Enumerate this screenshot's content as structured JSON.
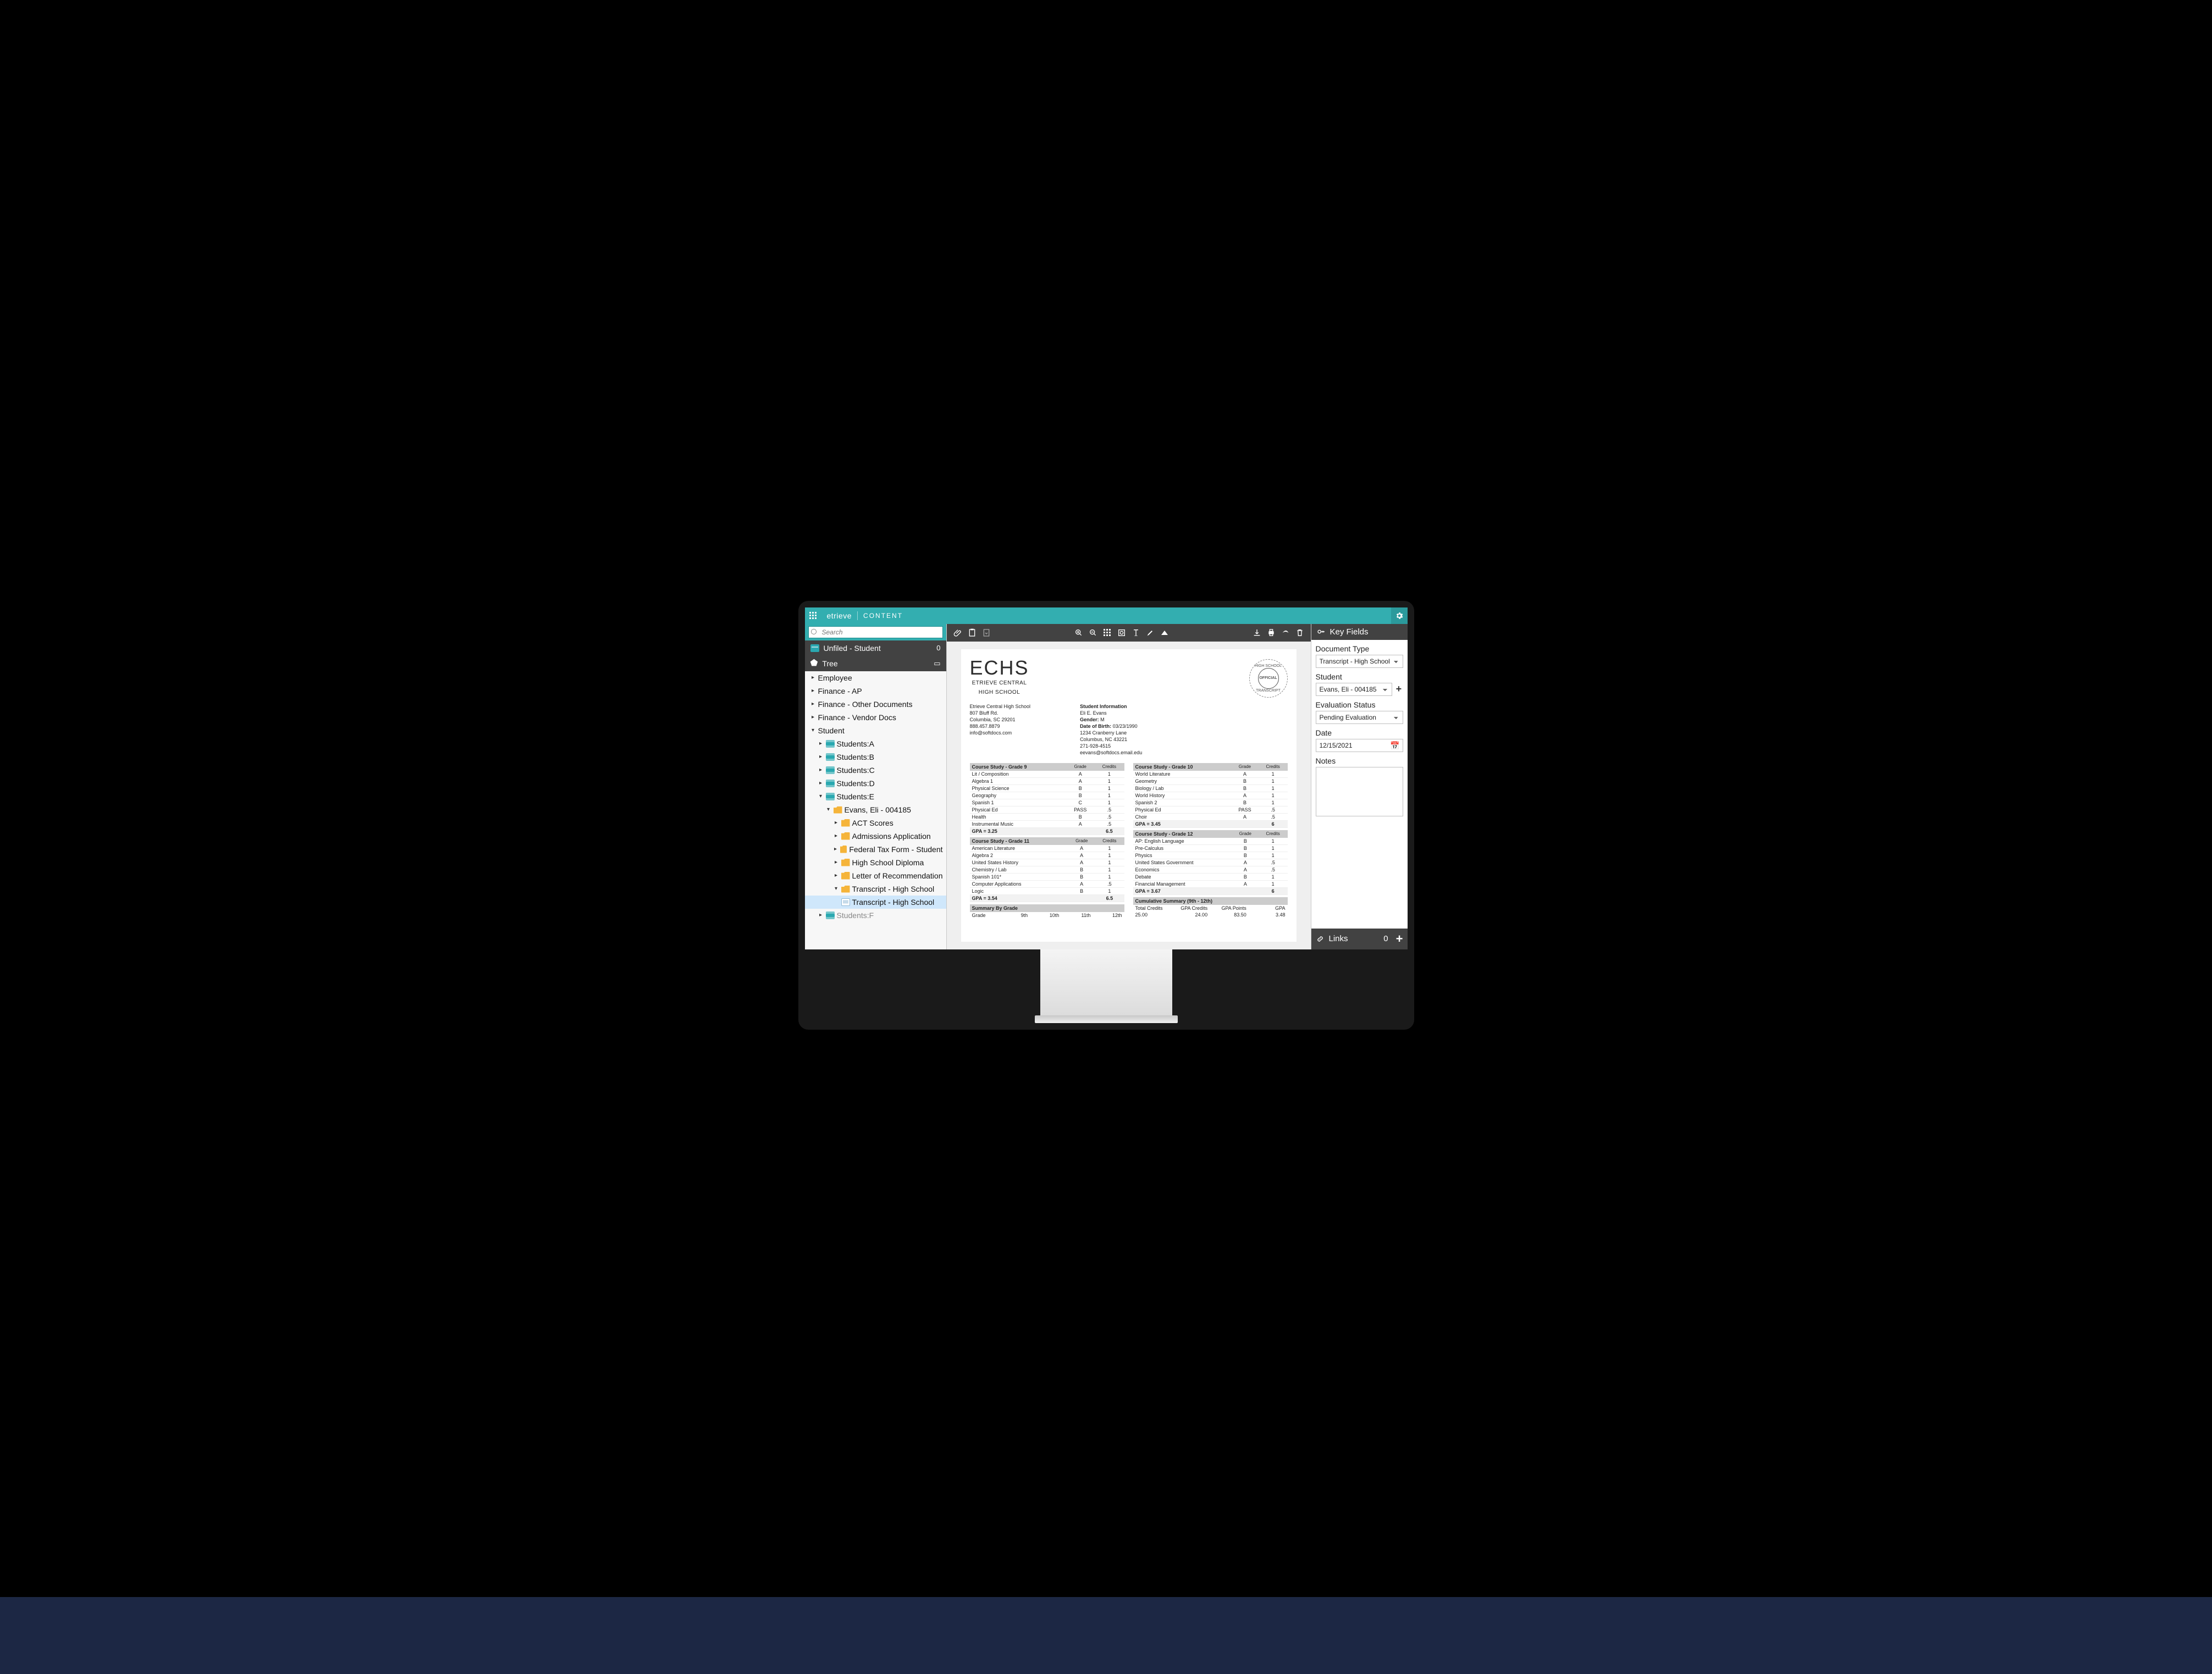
{
  "brand": {
    "name": "etrieve",
    "section": "CONTENT"
  },
  "search": {
    "placeholder": "Search"
  },
  "unfiled": {
    "label": "Unfiled - Student",
    "count": "0"
  },
  "tree": {
    "label": "Tree",
    "nodes": {
      "employee": "Employee",
      "finance_ap": "Finance - AP",
      "finance_other": "Finance - Other Documents",
      "finance_vendor": "Finance - Vendor Docs",
      "student": "Student",
      "students_a": "Students:A",
      "students_b": "Students:B",
      "students_c": "Students:C",
      "students_d": "Students:D",
      "students_e": "Students:E",
      "evans": "Evans, Eli - 004185",
      "act": "ACT Scores",
      "admissions": "Admissions Application",
      "tax": "Federal Tax Form - Student",
      "diploma": "High School Diploma",
      "letter": "Letter of Recommendation",
      "transcript_folder": "Transcript - High School",
      "transcript_doc": "Transcript - High School",
      "students_f_trunc": "Students:F"
    }
  },
  "keyfields": {
    "title": "Key Fields",
    "doc_type_label": "Document Type",
    "doc_type_value": "Transcript - High School",
    "student_label": "Student",
    "student_value": "Evans, Eli - 004185",
    "eval_label": "Evaluation Status",
    "eval_value": "Pending Evaluation",
    "date_label": "Date",
    "date_value": "12/15/2021",
    "notes_label": "Notes"
  },
  "links": {
    "label": "Links",
    "count": "0"
  },
  "doc": {
    "logo_main": "ECHS",
    "logo_sub1": "ETRIEVE CENTRAL",
    "logo_sub2": "HIGH SCHOOL",
    "seal_top": "HIGH SCHOOL",
    "seal_mid": "OFFICIAL",
    "seal_bot": "TRANSCRIPT",
    "school": {
      "name": "Etrieve Central High School",
      "addr1": "807 Bluff Rd.",
      "addr2": "Columbia, SC 29201",
      "phone": "888.457.8879",
      "email": "info@softdocs.com"
    },
    "student_hdr": "Student Information",
    "student": {
      "name": "Eli E. Evans",
      "gender_label": "Gender:",
      "gender": "M",
      "dob_label": "Date of Birth:",
      "dob": "03/23/1990",
      "addr1": "1234 Cranberry Lane",
      "addr2": "Columbus, NC 43221",
      "phone": "271-928-4515",
      "email": "eevans@softdocs.email.edu"
    },
    "cols": {
      "grade": "Grade",
      "credits": "Credits"
    },
    "g9": {
      "title": "Course Study - Grade 9",
      "rows": [
        [
          "Lit / Composition",
          "A",
          "1"
        ],
        [
          "Algebra 1",
          "A",
          "1"
        ],
        [
          "Physical Science",
          "B",
          "1"
        ],
        [
          "Geography",
          "B",
          "1"
        ],
        [
          "Spanish 1",
          "C",
          "1"
        ],
        [
          "Physical Ed",
          "PASS",
          ".5"
        ],
        [
          "Health",
          "B",
          ".5"
        ],
        [
          "Instrumental Music",
          "A",
          ".5"
        ]
      ],
      "gpa": [
        "GPA = 3.25",
        "",
        "6.5"
      ]
    },
    "g10": {
      "title": "Course Study - Grade 10",
      "rows": [
        [
          "World Literature",
          "A",
          "1"
        ],
        [
          "Geometry",
          "B",
          "1"
        ],
        [
          "Biology / Lab",
          "B",
          "1"
        ],
        [
          "World History",
          "A",
          "1"
        ],
        [
          "Spanish 2",
          "B",
          "1"
        ],
        [
          "Physical Ed",
          "PASS",
          ".5"
        ],
        [
          "Choir",
          "A",
          ".5"
        ]
      ],
      "gpa": [
        "GPA = 3.45",
        "",
        "6"
      ]
    },
    "g11": {
      "title": "Course Study - Grade 11",
      "rows": [
        [
          "American Literature",
          "A",
          "1"
        ],
        [
          "Algebra 2",
          "A",
          "1"
        ],
        [
          "United States History",
          "A",
          "1"
        ],
        [
          "Chemistry / Lab",
          "B",
          "1"
        ],
        [
          "Spanish 101*",
          "B",
          "1"
        ],
        [
          "Computer Applications",
          "A",
          ".5"
        ],
        [
          "Logic",
          "B",
          "1"
        ]
      ],
      "gpa": [
        "GPA = 3.54",
        "",
        "6.5"
      ]
    },
    "g12": {
      "title": "Course Study - Grade 12",
      "rows": [
        [
          "AP: English Language",
          "B",
          "1"
        ],
        [
          "Pre-Calculus",
          "B",
          "1"
        ],
        [
          "Physics",
          "B",
          "1"
        ],
        [
          "United States Government",
          "A",
          ".5"
        ],
        [
          "Economics",
          "A",
          ".5"
        ],
        [
          "Debate",
          "B",
          "1"
        ],
        [
          "Financial Management",
          "A",
          "1"
        ]
      ],
      "gpa": [
        "GPA = 3.67",
        "",
        "6"
      ]
    },
    "summary": {
      "title": "Summary By Grade",
      "h": [
        "Grade",
        "9th",
        "10th",
        "11th",
        "12th"
      ]
    },
    "cumulative": {
      "title": "Cumulative Summary (9th - 12th)",
      "h": [
        "Total Credits",
        "GPA Credits",
        "GPA Points",
        "GPA"
      ],
      "v": [
        "25.00",
        "24.00",
        "83.50",
        "3.48"
      ]
    }
  }
}
